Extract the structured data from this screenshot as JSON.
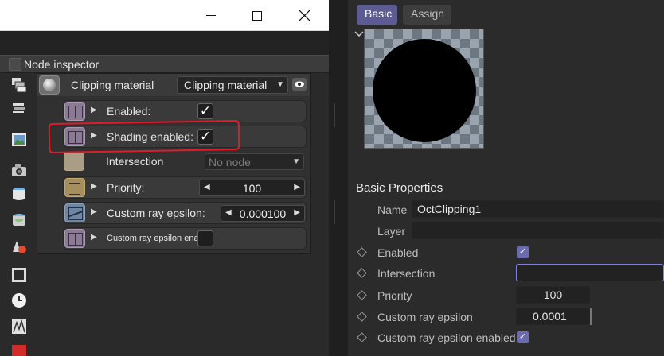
{
  "window_controls": {
    "minimize": "minimize",
    "maximize": "maximize",
    "close": "close"
  },
  "node_inspector": {
    "title": "Node inspector",
    "node_name": "Clipping material",
    "node_type": "Clipping material",
    "rows": [
      {
        "label": "Enabled:",
        "checked": true,
        "check_glyph": "✓"
      },
      {
        "label": "Shading enabled:",
        "checked": true,
        "check_glyph": "✓"
      },
      {
        "label": "Intersection",
        "value": "No node"
      },
      {
        "label": "Priority:",
        "value": "100"
      },
      {
        "label": "Custom ray epsilon:",
        "value": "0.000100"
      },
      {
        "label": "Custom ray epsilon ena...",
        "checked": false
      }
    ]
  },
  "toolbar_icons": [
    "layers-icon",
    "stack-icon",
    "image-icon",
    "camera-icon",
    "database-icon",
    "cylinder-icon",
    "shapes-icon",
    "frame-icon",
    "clock-icon",
    "fractal-icon",
    "cube-icon"
  ],
  "material_panel": {
    "tabs": [
      "Basic",
      "Assign"
    ],
    "section_title": "Basic Properties",
    "name_label": "Name",
    "name_value": "OctClipping1",
    "layer_label": "Layer",
    "layer_value": "",
    "properties": [
      {
        "label": "Enabled",
        "checked": true,
        "check_glyph": "✓"
      },
      {
        "label": "Intersection",
        "value": ""
      },
      {
        "label": "Priority",
        "value": "100"
      },
      {
        "label": "Custom ray epsilon",
        "value": "0.0001"
      },
      {
        "label": "Custom ray epsilon enabled",
        "checked": true,
        "check_glyph": "✓"
      }
    ]
  },
  "colors": {
    "accent": "#5c5c92",
    "annotation_red": "#e11b2a",
    "focus_border": "#7f7fe0"
  }
}
